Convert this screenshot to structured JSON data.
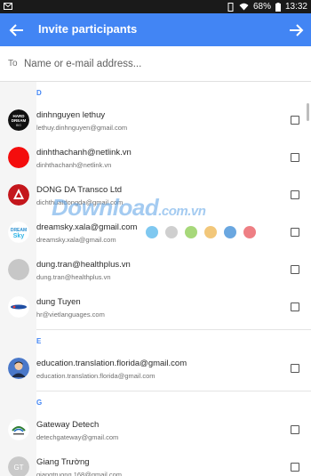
{
  "status_bar": {
    "battery_percent": "68%",
    "time": "13:32"
  },
  "app_bar": {
    "title": "Invite participants"
  },
  "to_field": {
    "label": "To",
    "placeholder": "Name or e-mail address..."
  },
  "sections": [
    {
      "letter": "D",
      "contacts": [
        {
          "name": "dinhnguyen lethuy",
          "email": "lethuy.dinhnguyen@gmail.com",
          "avatar": "album-art",
          "checked": false
        },
        {
          "name": "dinhthachanh@netlink.vn",
          "email": "dinhthachanh@netlink.vn",
          "avatar": "red-circle",
          "checked": false
        },
        {
          "name": "DONG DA Transco Ltd",
          "email": "dichthuatdongda@gmail.com",
          "avatar": "dongda-logo",
          "checked": false
        },
        {
          "name": "dreamsky.xala@gmail.com",
          "email": "dreamsky.xala@gmail.com",
          "avatar": "dreamsky-logo",
          "checked": false
        },
        {
          "name": "dung.tran@healthplus.vn",
          "email": "dung.tran@healthplus.vn",
          "avatar": "grey-circle",
          "checked": false
        },
        {
          "name": "dung Tuyen",
          "email": "hr@vietlanguages.com",
          "avatar": "vietlang-logo",
          "checked": false
        }
      ]
    },
    {
      "letter": "E",
      "contacts": [
        {
          "name": "education.translation.florida@gmail.com",
          "email": "education.translation.florida@gmail.com",
          "avatar": "person-photo",
          "checked": false
        }
      ]
    },
    {
      "letter": "G",
      "contacts": [
        {
          "name": "Gateway Detech",
          "email": "detechgateway@gmail.com",
          "avatar": "gateway-logo",
          "checked": false
        },
        {
          "name": "Giang Trường",
          "email": "giangtruong.168@gmail.com",
          "avatar": "initials",
          "initials": "GT",
          "checked": false
        }
      ]
    }
  ],
  "watermark": {
    "text": "Download",
    "suffix": ".com.vn",
    "dot_colors": [
      "#7fc8f0",
      "#cfcfcf",
      "#a7d87a",
      "#f2c77a",
      "#6aa7e0",
      "#ee7f84"
    ]
  },
  "colors": {
    "accent": "#4285f4",
    "status_bar": "#1a1a1a"
  }
}
